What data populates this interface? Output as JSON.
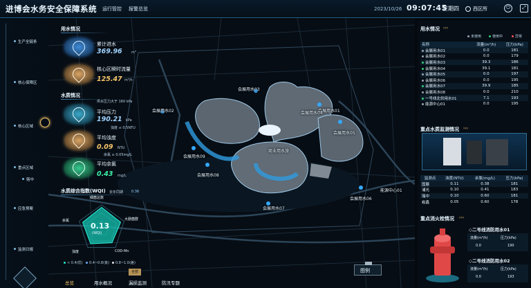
{
  "header": {
    "title": "进博会水务安全保障系统",
    "tabs": [
      {
        "label": "运行管控"
      },
      {
        "label": "报警总览"
      }
    ],
    "date": "2023/10/26",
    "time": "09:07:45",
    "weekday": "星期四",
    "location": "西区所"
  },
  "left_nav": [
    {
      "label": "生产全链条"
    },
    {
      "label": "核心保障区"
    },
    {
      "label": "核心区域"
    },
    {
      "label": "重点区域"
    },
    {
      "label": "辖中"
    },
    {
      "label": "应急预案"
    },
    {
      "label": "监测日报"
    }
  ],
  "water_usage": {
    "title": "用水情况",
    "cumulative_label": "累计进水",
    "cumulative_value": "369.96",
    "cumulative_unit": "m³",
    "flow_label": "核心区瞬时流量",
    "flow_value": "125.47",
    "flow_unit": "m³/h"
  },
  "water_quality": {
    "title": "水质情况",
    "pressure_note": "供水压力大于 160 kPa",
    "pressure_label": "平均压力",
    "pressure_value": "190.21",
    "pressure_unit": "kPa",
    "turbidity_note": "浊度 ≤ 0.5NTU",
    "turbidity_label": "平均浊度",
    "turbidity_value": "0.09",
    "turbidity_unit": "NTU",
    "chlorine_note": "余氯 ≥ 0.05mg/L",
    "chlorine_label": "平均余氯",
    "chlorine_value": "0.43",
    "chlorine_unit": "mg/L"
  },
  "wqi": {
    "title": "水质综合指数(WQI)",
    "compare_label": "去年同期",
    "compare_value": "0.36",
    "value": "0.13",
    "value_label": "(WQI)",
    "axes": [
      "细菌总数",
      "大肠菌群",
      "COD-Mn",
      "浊度",
      "余氯"
    ],
    "legend": [
      "< 0.4(优)",
      "0.4~0.8(良)",
      "0.8~1.0(差)"
    ],
    "values": [
      0.35,
      0.3,
      0.2,
      0.25,
      0.3
    ],
    "axis_max": 1
  },
  "map_labels": [
    "会展用水03",
    "会展用水01",
    "会展用水02",
    "会展用水04",
    "会展用水05",
    "会展用水06",
    "会展用水07",
    "会展用水08",
    "会展用水09",
    "商业用水旅",
    "能源中心01"
  ],
  "map_buttons": {
    "all_label": "全部",
    "legend_label": "图例"
  },
  "bottom_tabs": [
    "总览",
    "用水概况",
    "漏损监测",
    "防汛专题"
  ],
  "right_water": {
    "title": "用水情况",
    "legend": [
      {
        "label": "未使用",
        "color": "#9aa6b2"
      },
      {
        "label": "使用中",
        "color": "#36d07a"
      },
      {
        "label": "异常",
        "color": "#ff5252"
      }
    ],
    "columns": [
      "名称",
      "流量(m³/h)",
      "压力(kPa)"
    ],
    "rows": [
      [
        "会展用水01",
        "0.0",
        "181"
      ],
      [
        "会展用水02",
        "0.0",
        "179"
      ],
      [
        "会展用水03",
        "39.3",
        "186"
      ],
      [
        "会展用水04",
        "39.1",
        "181"
      ],
      [
        "会展用水05",
        "0.0",
        "197"
      ],
      [
        "会展用水06",
        "0.0",
        "195"
      ],
      [
        "会展用水07",
        "39.9",
        "185"
      ],
      [
        "会展用水08",
        "0.0",
        "210"
      ],
      [
        "一号线北供用水01",
        "7.1",
        "193"
      ],
      [
        "能源中心01",
        "0.0",
        "195"
      ]
    ]
  },
  "quality_monitor": {
    "title": "重点水质监测情况",
    "columns": [
      "监测点",
      "浊度(NTU)",
      "余氯(mg/L)",
      "压力(kPa)"
    ],
    "rows": [
      [
        "国展",
        "0.11",
        "0.38",
        "181"
      ],
      [
        "浦光",
        "0.10",
        "0.41",
        "183"
      ],
      [
        "瑞中",
        "0.10",
        "0.60",
        "181"
      ],
      [
        "崧鑫",
        "0.05",
        "0.60",
        "178"
      ]
    ]
  },
  "hydrant": {
    "title": "重点消火栓情况",
    "items": [
      {
        "name": "◇二号线消防用水01",
        "flow_label": "流量(m³/h)",
        "pressure_label": "压力(kPa)",
        "flow": "0.0",
        "pressure": "190"
      },
      {
        "name": "◇二号线消防用水02",
        "flow_label": "流量(m³/h)",
        "pressure_label": "压力(kPa)",
        "flow": "0.0",
        "pressure": "193"
      }
    ]
  },
  "colors": {
    "accent": "#00e0d0",
    "gold": "#f5c46a",
    "blue": "#3ab0ff"
  }
}
